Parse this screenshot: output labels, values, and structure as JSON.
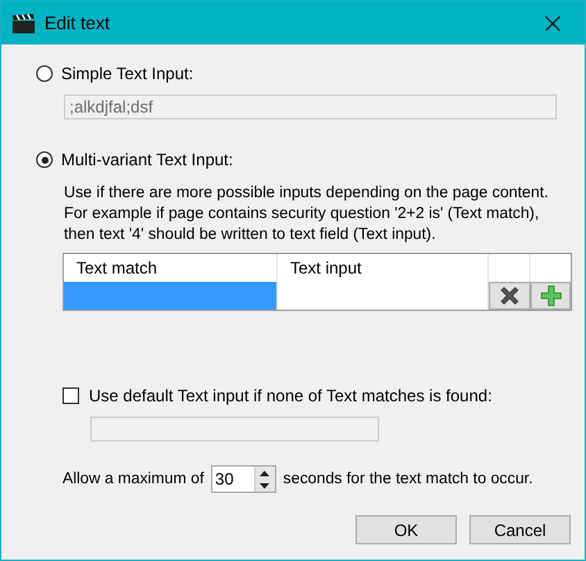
{
  "window": {
    "title": "Edit text"
  },
  "modes": [
    {
      "label": "Simple Text Input:",
      "selected": false
    },
    {
      "label": "Multi-variant Text Input:",
      "selected": true
    }
  ],
  "simple_input": {
    "value": ";alkdjfal;dsf",
    "disabled": true
  },
  "description": "Use if there are more possible inputs depending on the page content. For example if page contains security question '2+2 is' (Text match), then text '4' should be written to text field (Text input).",
  "table": {
    "columns": [
      "Text match",
      "Text input"
    ],
    "rows": [
      {
        "selected": true
      }
    ]
  },
  "default_option": {
    "label": "Use default Text input if none of Text matches is found:",
    "checked": false
  },
  "timeout": {
    "before": "Allow a maximum of",
    "value": "30",
    "after": "seconds for the text match to occur."
  },
  "buttons": [
    "OK",
    "Cancel"
  ]
}
